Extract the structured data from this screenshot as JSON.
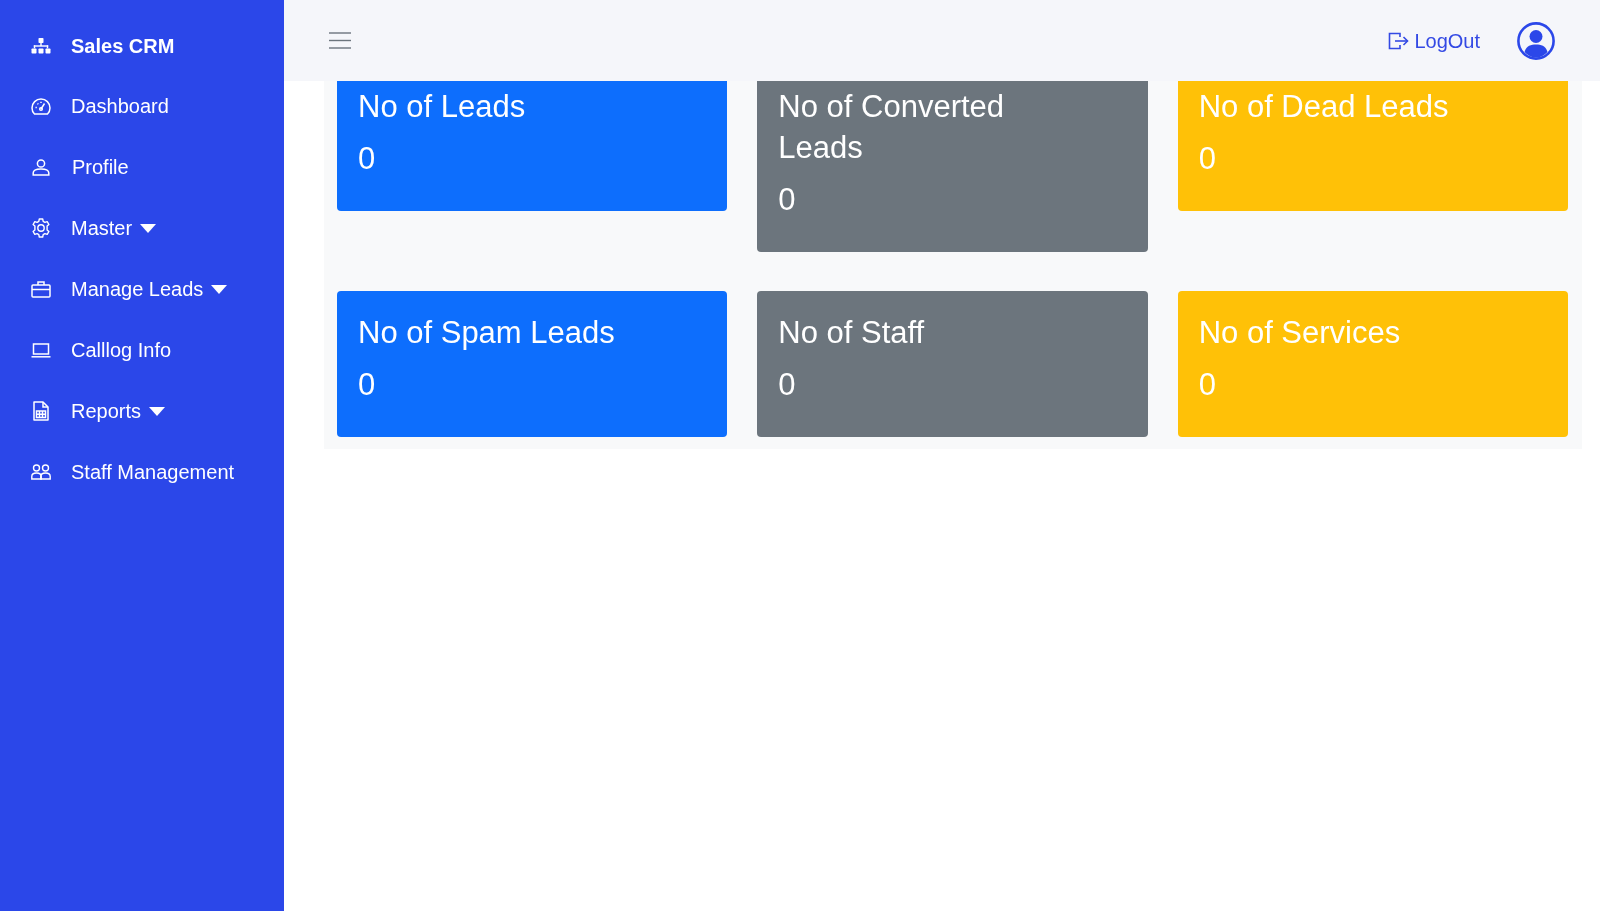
{
  "sidebar": {
    "brand": "Sales CRM",
    "items": [
      {
        "label": "Dashboard",
        "kind": "link"
      },
      {
        "label": "Profile",
        "kind": "link"
      },
      {
        "label": "Master",
        "kind": "dropdown"
      },
      {
        "label": "Manage Leads",
        "kind": "dropdown"
      },
      {
        "label": "Calllog Info",
        "kind": "link"
      },
      {
        "label": "Reports",
        "kind": "dropdown"
      },
      {
        "label": "Staff Management",
        "kind": "link"
      }
    ]
  },
  "header": {
    "logout": "LogOut"
  },
  "stats": [
    {
      "label": "No of Leads",
      "value": "0",
      "color": "#0d6efd"
    },
    {
      "label": "No of Converted Leads",
      "value": "0",
      "color": "#6c757d"
    },
    {
      "label": "No of Dead Leads",
      "value": "0",
      "color": "#ffc107"
    },
    {
      "label": "No of Spam Leads",
      "value": "0",
      "color": "#0d6efd"
    },
    {
      "label": "No of Staff",
      "value": "0",
      "color": "#6c757d"
    },
    {
      "label": "No of Services",
      "value": "0",
      "color": "#ffc107"
    }
  ]
}
